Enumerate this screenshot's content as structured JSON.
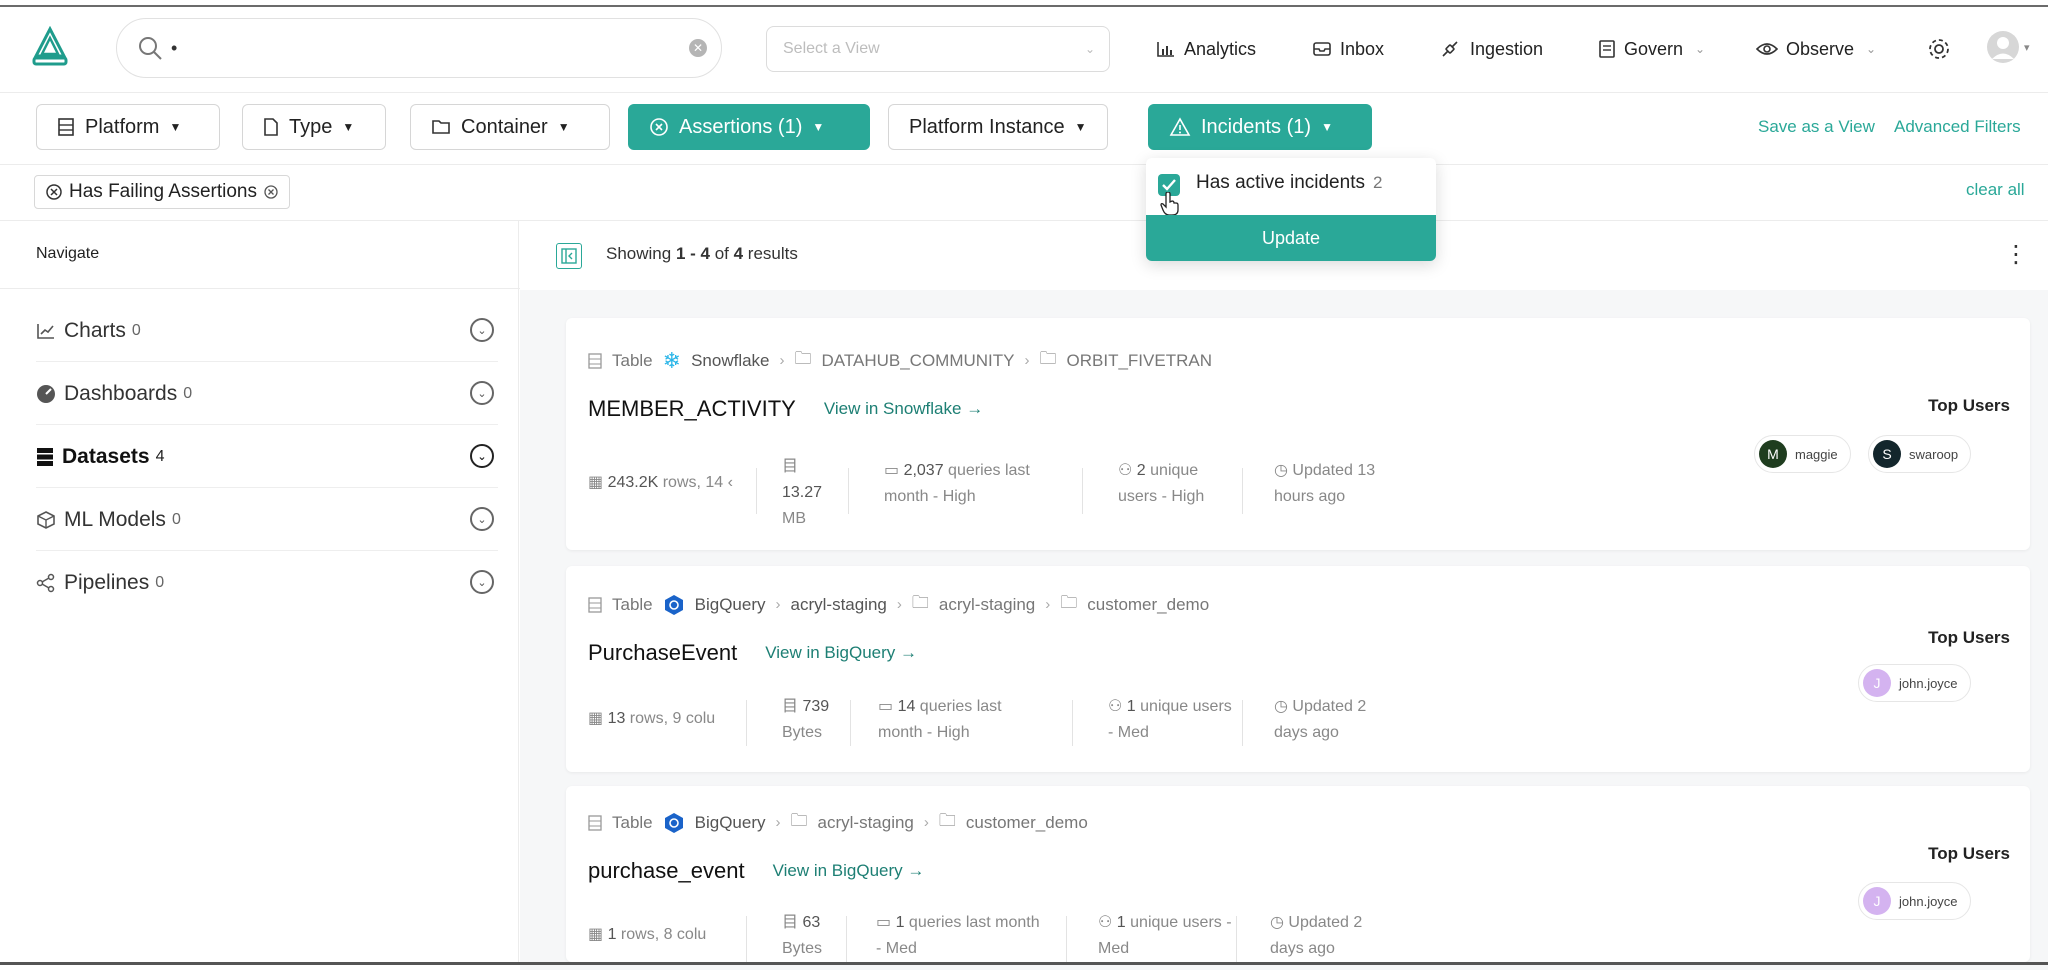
{
  "search": {
    "value": "•"
  },
  "view_select": {
    "placeholder": "Select a View"
  },
  "nav": {
    "analytics": "Analytics",
    "inbox": "Inbox",
    "ingestion": "Ingestion",
    "govern": "Govern",
    "observe": "Observe"
  },
  "filters": {
    "platform": "Platform",
    "type": "Type",
    "container": "Container",
    "assertions": "Assertions (1)",
    "platform_instance": "Platform Instance",
    "incidents": "Incidents (1)",
    "save_view": "Save as a View",
    "advanced": "Advanced Filters",
    "clear_all": "clear all"
  },
  "active_chip": "Has Failing Assertions",
  "dropdown": {
    "option_label": "Has active incidents",
    "option_count": "2",
    "update": "Update"
  },
  "sidebar": {
    "title": "Navigate",
    "items": [
      {
        "label": "Charts",
        "count": "0"
      },
      {
        "label": "Dashboards",
        "count": "0"
      },
      {
        "label": "Datasets",
        "count": "4"
      },
      {
        "label": "ML Models",
        "count": "0"
      },
      {
        "label": "Pipelines",
        "count": "0"
      }
    ]
  },
  "results": {
    "showing_prefix": "Showing ",
    "range": "1 - 4",
    "of": " of ",
    "total": "4",
    "suffix": " results"
  },
  "cards": [
    {
      "type": "Table",
      "platform": "Snowflake",
      "path": [
        "DATAHUB_COMMUNITY",
        "ORBIT_FIVETRAN"
      ],
      "name": "MEMBER_ACTIVITY",
      "view_link": "View in Snowflake",
      "rows": "243.2K",
      "rows_suffix": " rows, 14 ‹",
      "size_num": "13.27",
      "size_unit": "MB",
      "queries_num": "2,037",
      "queries_line1": " queries last",
      "queries_line2": "month - High",
      "users_num": "2",
      "users_line1": " unique",
      "users_line2": "users - High",
      "updated_line1": "Updated 13",
      "updated_line2": "hours ago",
      "top_users_label": "Top Users",
      "users": [
        {
          "initial": "M",
          "name": "maggie",
          "color": "#1f3d1f"
        },
        {
          "initial": "S",
          "name": "swaroop",
          "color": "#13262c"
        }
      ]
    },
    {
      "type": "Table",
      "platform": "BigQuery",
      "path": [
        "acryl-staging",
        "acryl-staging",
        "customer_demo"
      ],
      "name": "PurchaseEvent",
      "view_link": "View in BigQuery",
      "rows": "13",
      "rows_suffix": " rows, 9 colu",
      "size_num": "739",
      "size_unit": "Bytes",
      "queries_num": "14",
      "queries_line1": " queries last",
      "queries_line2": "month - High",
      "users_num": "1",
      "users_line1": " unique users",
      "users_line2": "- Med",
      "updated_line1": "Updated 2",
      "updated_line2": "days ago",
      "top_users_label": "Top Users",
      "users": [
        {
          "initial": "J",
          "name": "john.joyce",
          "color": "#d4b3f0"
        }
      ]
    },
    {
      "type": "Table",
      "platform": "BigQuery",
      "path": [
        "acryl-staging",
        "customer_demo"
      ],
      "name": "purchase_event",
      "view_link": "View in BigQuery",
      "rows": "1",
      "rows_suffix": " rows, 8 colu",
      "size_num": "63",
      "size_unit": "Bytes",
      "queries_num": "1",
      "queries_line1": " queries last month",
      "queries_line2": "- Med",
      "users_num": "1",
      "users_line1": " unique users -",
      "users_line2": "Med",
      "updated_line1": "Updated 2",
      "updated_line2": "days ago",
      "top_users_label": "Top Users",
      "users": [
        {
          "initial": "J",
          "name": "john.joyce",
          "color": "#d4b3f0"
        }
      ]
    }
  ],
  "colors": {
    "accent": "#2aa898",
    "link": "#1d7f74"
  }
}
